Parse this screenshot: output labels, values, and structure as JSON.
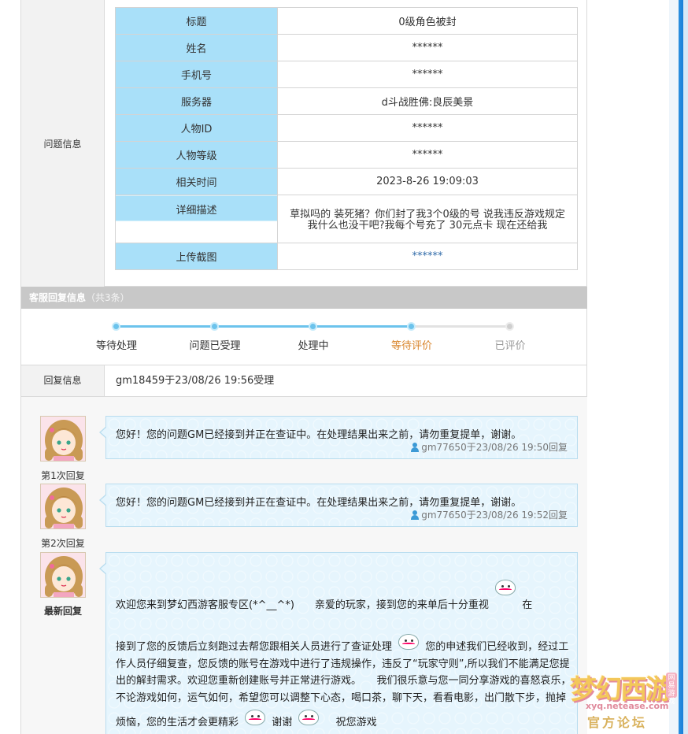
{
  "question": {
    "section_label": "问题信息",
    "rows": [
      {
        "key": "标题",
        "value": "0级角色被封"
      },
      {
        "key": "姓名",
        "value": "******"
      },
      {
        "key": "手机号",
        "value": "******"
      },
      {
        "key": "服务器",
        "value": "d斗战胜佛:良辰美景"
      },
      {
        "key": "人物ID",
        "value": "******"
      },
      {
        "key": "人物等级",
        "value": "******"
      },
      {
        "key": "相关时间",
        "value": "2023-8-26 19:09:03"
      }
    ],
    "desc_key": "详细描述",
    "desc_value": "草拟吗的 装死猪？你们封了我3个0级的号 说我违反游戏规定 我什么也没干吧?我每个号充了 30元点卡 现在还给我",
    "upload_key": "上传截图",
    "upload_value": "******"
  },
  "reply_bar": {
    "title": "客服回复信息",
    "count": "（共3条）"
  },
  "progress": {
    "steps": [
      "等待处理",
      "问题已受理",
      "处理中",
      "等待评价",
      "已评价"
    ],
    "current_index": 3
  },
  "reply_info": {
    "label": "回复信息",
    "value": "gm18459于23/08/26 19:56受理"
  },
  "replies": [
    {
      "label": "第1次回复",
      "message": "您好！您的问题GM已经接到并正在查证中。在处理结果出来之前，请勿重复提单，谢谢。",
      "meta": "gm77650于23/08/26 19:50回复"
    },
    {
      "label": "第2次回复",
      "message": "您好！您的问题GM已经接到并正在查证中。在处理结果出来之前，请勿重复提单，谢谢。",
      "meta": "gm77650于23/08/26 19:52回复"
    }
  ],
  "latest": {
    "label": "最新回复",
    "p1": "欢迎您来到梦幻西游客服专区(*^__^*)　　亲爱的玩家，接到您的来单后十分重视",
    "p2": "在",
    "p3": "接到了您的反馈后立刻跑过去帮您跟相关人员进行了查证处理",
    "p4": "您的申述我们已经收到，经过工作人员仔细复查，您反馈的账号在游戏中进行了违规操作，违反了“玩家守则”,所以我们不能满足您提出的解封需求。欢迎您重新创建账号并正常进行游戏。　　我们很乐意与您一同分享游戏的喜怒哀乐，不论游戏如何，运气如何，希望您可以调整下心态，喝口茶，聊下天，看看电影，出门散下步，抛掉烦恼，您的生活才会更精彩",
    "p5": "谢谢",
    "p6": "　祝您游戏"
  },
  "watermark": {
    "main": "梦幻西游",
    "site": "xyq.netease.com",
    "tag": "官方论坛",
    "badge": "网易游戏"
  },
  "colors": {
    "key_cell": "#a9e0f9",
    "bubble": "#e6f5fd",
    "progress_done": "#6cc3ec",
    "current_step": "#d8842a"
  }
}
